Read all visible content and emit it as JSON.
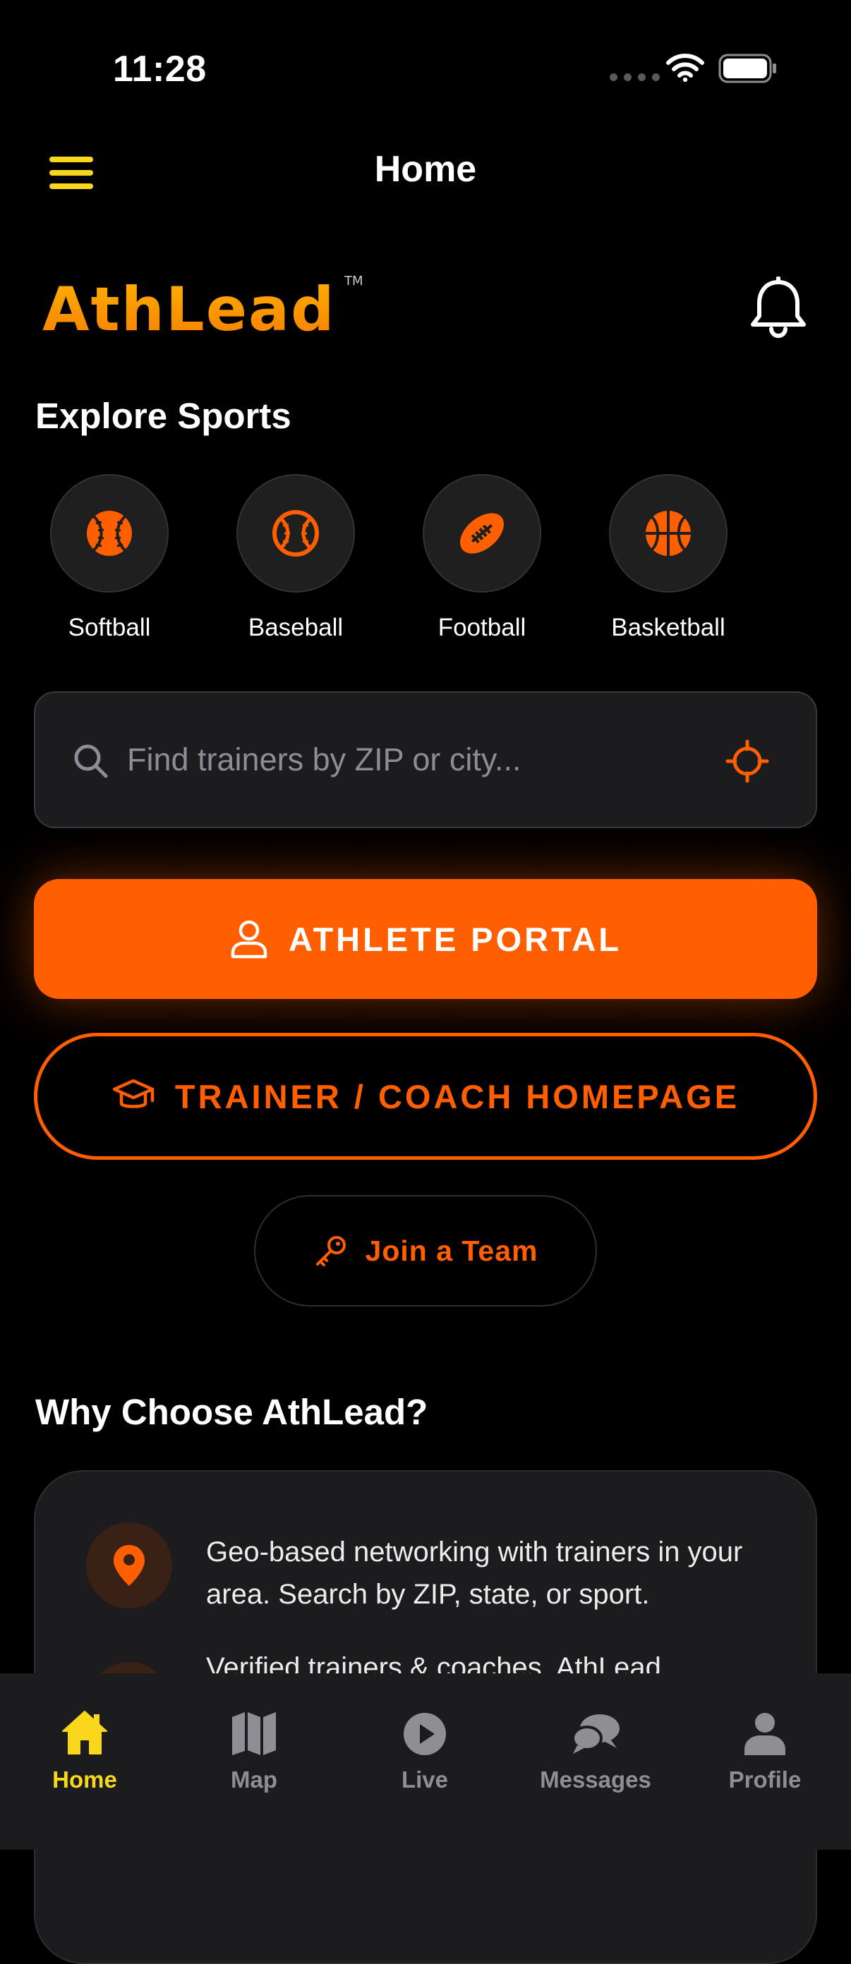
{
  "status_bar": {
    "time": "11:28"
  },
  "header": {
    "title": "Home"
  },
  "brand": {
    "name": "AthLead",
    "trademark": "TM"
  },
  "explore": {
    "title": "Explore Sports",
    "sports": [
      {
        "label": "Softball",
        "icon": "softball-icon"
      },
      {
        "label": "Baseball",
        "icon": "baseball-icon"
      },
      {
        "label": "Football",
        "icon": "football-icon"
      },
      {
        "label": "Basketball",
        "icon": "basketball-icon"
      }
    ]
  },
  "search": {
    "placeholder": "Find trainers by ZIP or city...",
    "value": ""
  },
  "buttons": {
    "athlete_portal": "ATHLETE PORTAL",
    "trainer_homepage": "TRAINER / COACH HOMEPAGE",
    "join_team": "Join a Team"
  },
  "why": {
    "title": "Why Choose AthLead?",
    "features": [
      {
        "text": "Geo-based networking with trainers in your area. Search by ZIP, state, or sport.",
        "icon": "location-pin-icon"
      },
      {
        "text": "Verified trainers & coaches. AthLead",
        "icon": "verified-icon"
      }
    ]
  },
  "tabbar": {
    "tabs": [
      {
        "label": "Home",
        "icon": "home-icon",
        "active": true
      },
      {
        "label": "Map",
        "icon": "map-icon",
        "active": false
      },
      {
        "label": "Live",
        "icon": "play-icon",
        "active": false
      },
      {
        "label": "Messages",
        "icon": "messages-icon",
        "active": false
      },
      {
        "label": "Profile",
        "icon": "profile-icon",
        "active": false
      }
    ]
  },
  "colors": {
    "accent_orange": "#FF5F00",
    "accent_yellow": "#F9D71C",
    "background": "#000000",
    "surface": "#1C1C1E"
  }
}
